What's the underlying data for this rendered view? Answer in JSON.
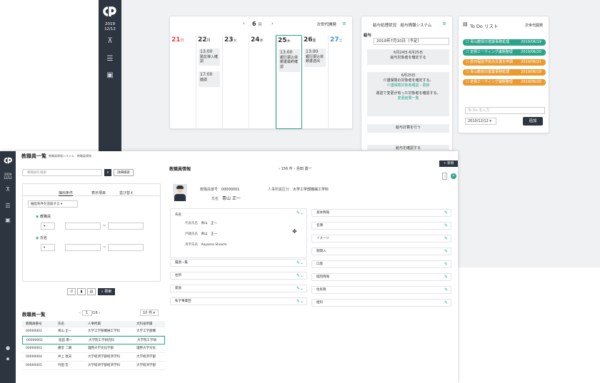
{
  "back": {
    "sidebar": {
      "year": "2019",
      "date": "12/12"
    },
    "calendar": {
      "prev": "‹",
      "next": "›",
      "month_num": "6",
      "month_unit": "月",
      "owner": "次世代開発",
      "days": [
        {
          "num": "21",
          "wk": "日",
          "color": "#e0474c"
        },
        {
          "num": "22",
          "wk": "月",
          "color": "#333"
        },
        {
          "num": "23",
          "wk": "火",
          "color": "#333"
        },
        {
          "num": "24",
          "wk": "水",
          "color": "#333"
        },
        {
          "num": "25",
          "wk": "木",
          "color": "#333"
        },
        {
          "num": "26",
          "wk": "金",
          "color": "#333"
        },
        {
          "num": "27",
          "wk": "土",
          "color": "#3a8fd6"
        }
      ],
      "events": {
        "mon1": {
          "time": "13:00",
          "text": "勤怠導入確認"
        },
        "mon2": {
          "time": "17:00",
          "text": "面談"
        },
        "thu1": {
          "time": "13:00",
          "text": "銀行振込依頼書最終確認"
        },
        "fri1": {
          "time": "13:00",
          "text": "銀行振込依頼書送出"
        }
      }
    },
    "payroll": {
      "title": "給与処理状況　給与情報システム",
      "label": "給与",
      "date": "2019年7月10日（予定）",
      "step1_range": "6月24日-6月25日",
      "step1_text": "給与対象者を確定する",
      "step2_date": "6月25日",
      "step2_text": "介護保険の対象者を確定する。",
      "step2_link": "介護保険対象者確認・更新",
      "step2_text2": "運送で変更が有った対象者を確認する。",
      "step2_link2": "変更結果一覧",
      "step3": "給与計算を行う",
      "step4": "給与を確認する"
    },
    "todo": {
      "title": "To Do リスト",
      "owner": "次世代開発",
      "items": [
        {
          "text": "青山教授の措置事務処理",
          "date": "2019/06/19",
          "color": "#2aa38a"
        },
        {
          "text": "定例ミーティング議題整理",
          "date": "2019/06/20",
          "color": "#2aa38a"
        },
        {
          "text": "前日程前予定の文書を申請",
          "date": "2019/06/21",
          "color": "#ea9a2f"
        },
        {
          "text": "青山教授の措置事務処理",
          "date": "2019/06/19",
          "color": "#ea9a2f"
        },
        {
          "text": "定例ミーティング議題整理",
          "date": "2019/06/20",
          "color": "#ea9a2f"
        }
      ],
      "input_placeholder": "To Do を入力",
      "date_value": "2010/12/12",
      "add_label": "追加"
    }
  },
  "front": {
    "sidebar": {
      "year": "2019",
      "date": "12/12"
    },
    "header": "教職員一覧",
    "subtitle": "教職員情報システム　教職員情報",
    "search_placeholder": "教職員を検索",
    "adv_search": "詳細検索",
    "tabs": [
      "抽出条件",
      "表示項目",
      "並び替え"
    ],
    "add_condition": "抽出条件を追加する",
    "cond1": "教職員",
    "cond2": "氏名",
    "tilde": "~",
    "search_btn": "検索",
    "list_title": "教職員一覧",
    "page_current": "1",
    "page_total": "/16",
    "per_page": "10 件",
    "columns": [
      "教職員番号",
      "氏名",
      "人事所属",
      "文科省所属"
    ],
    "rows": [
      [
        "00000001",
        "青山 正一",
        "大学工学部機械工学科",
        "大学工学部機"
      ],
      [
        "00000002",
        "島田 勇一",
        "大学院工学研究科",
        "大学院工学研"
      ],
      [
        "00000003",
        "藤堂 二朗",
        "理際大学文化学部",
        "理際大学文化"
      ],
      [
        "00000004",
        "井上 敦夫",
        "大学経済学部経済学科",
        "大学経済学部"
      ],
      [
        "00000005",
        "竹田 哲",
        "大学経済学部経済学科",
        "大学経済学部"
      ]
    ],
    "info": {
      "title": "教職員情報",
      "count": "156 件",
      "current_name": "島田 勇一",
      "new_btn": "新規",
      "no_label": "教職員番号",
      "no_value": "00000001",
      "dept_label": "人事所属区分",
      "dept_value": "大学工学部機械工学科",
      "name_label": "氏名",
      "name_value": "青山 正一",
      "section_name": "氏名",
      "rep_label": "代表氏名",
      "rep_value": "青山　正一",
      "reg_label": "戸籍氏名",
      "reg_value": "青山　正一",
      "en_label": "英字氏名",
      "en_value": "Aoyama Shoichi",
      "left_sections": [
        "履歴一覧",
        "住所",
        "家族",
        "私学事業団"
      ],
      "right_sections": [
        "基本情報",
        "名簿",
        "イメージ",
        "期間入",
        "口座",
        "個別情報",
        "住民税",
        "給料"
      ]
    }
  }
}
